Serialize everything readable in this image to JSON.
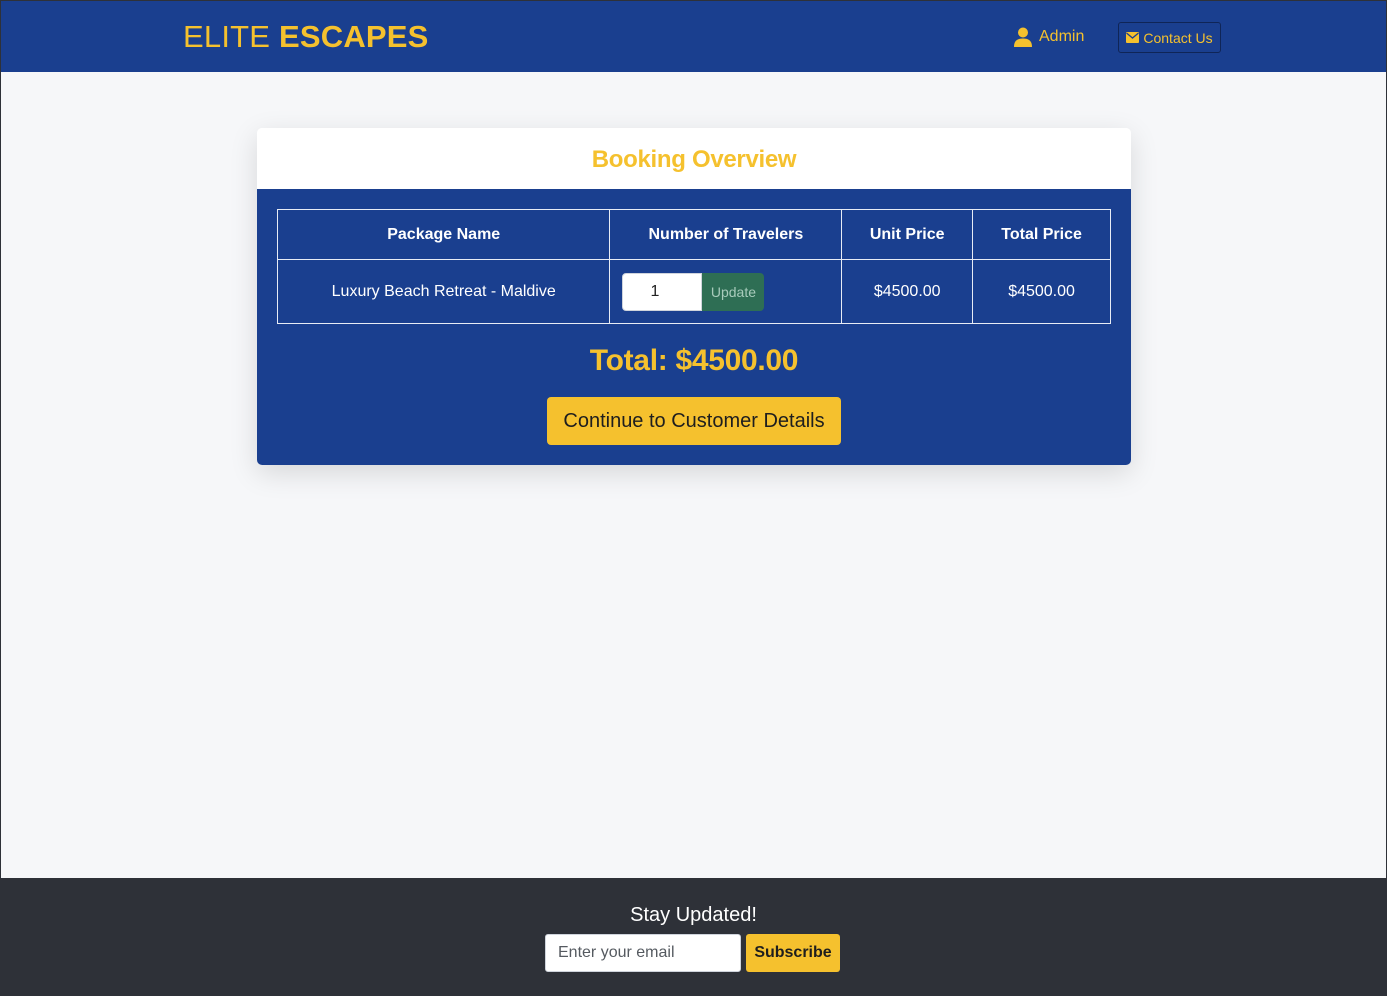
{
  "header": {
    "brand_part1": "ELITE",
    "brand_part2": "ESCAPES",
    "admin_label": "Admin",
    "admin_icon": "user-icon",
    "contact_label": "Contact Us",
    "contact_icon": "envelope-icon"
  },
  "booking": {
    "title": "Booking Overview",
    "columns": [
      "Package Name",
      "Number of Travelers",
      "Unit Price",
      "Total Price"
    ],
    "row": {
      "package_name": "Luxury Beach Retreat - Maldive",
      "travelers": "1",
      "update_label": "Update",
      "unit_price": "$4500.00",
      "total_price": "$4500.00"
    },
    "total_text": "Total: $4500.00",
    "continue_label": "Continue to Customer Details"
  },
  "footer": {
    "title": "Stay Updated!",
    "email_placeholder": "Enter your email",
    "subscribe_label": "Subscribe"
  },
  "colors": {
    "primary_blue": "#1a3f8f",
    "accent_gold": "#f5c12e",
    "update_green": "#2e6e54",
    "footer_dark": "#2e3138",
    "page_bg": "#f6f7f9"
  }
}
